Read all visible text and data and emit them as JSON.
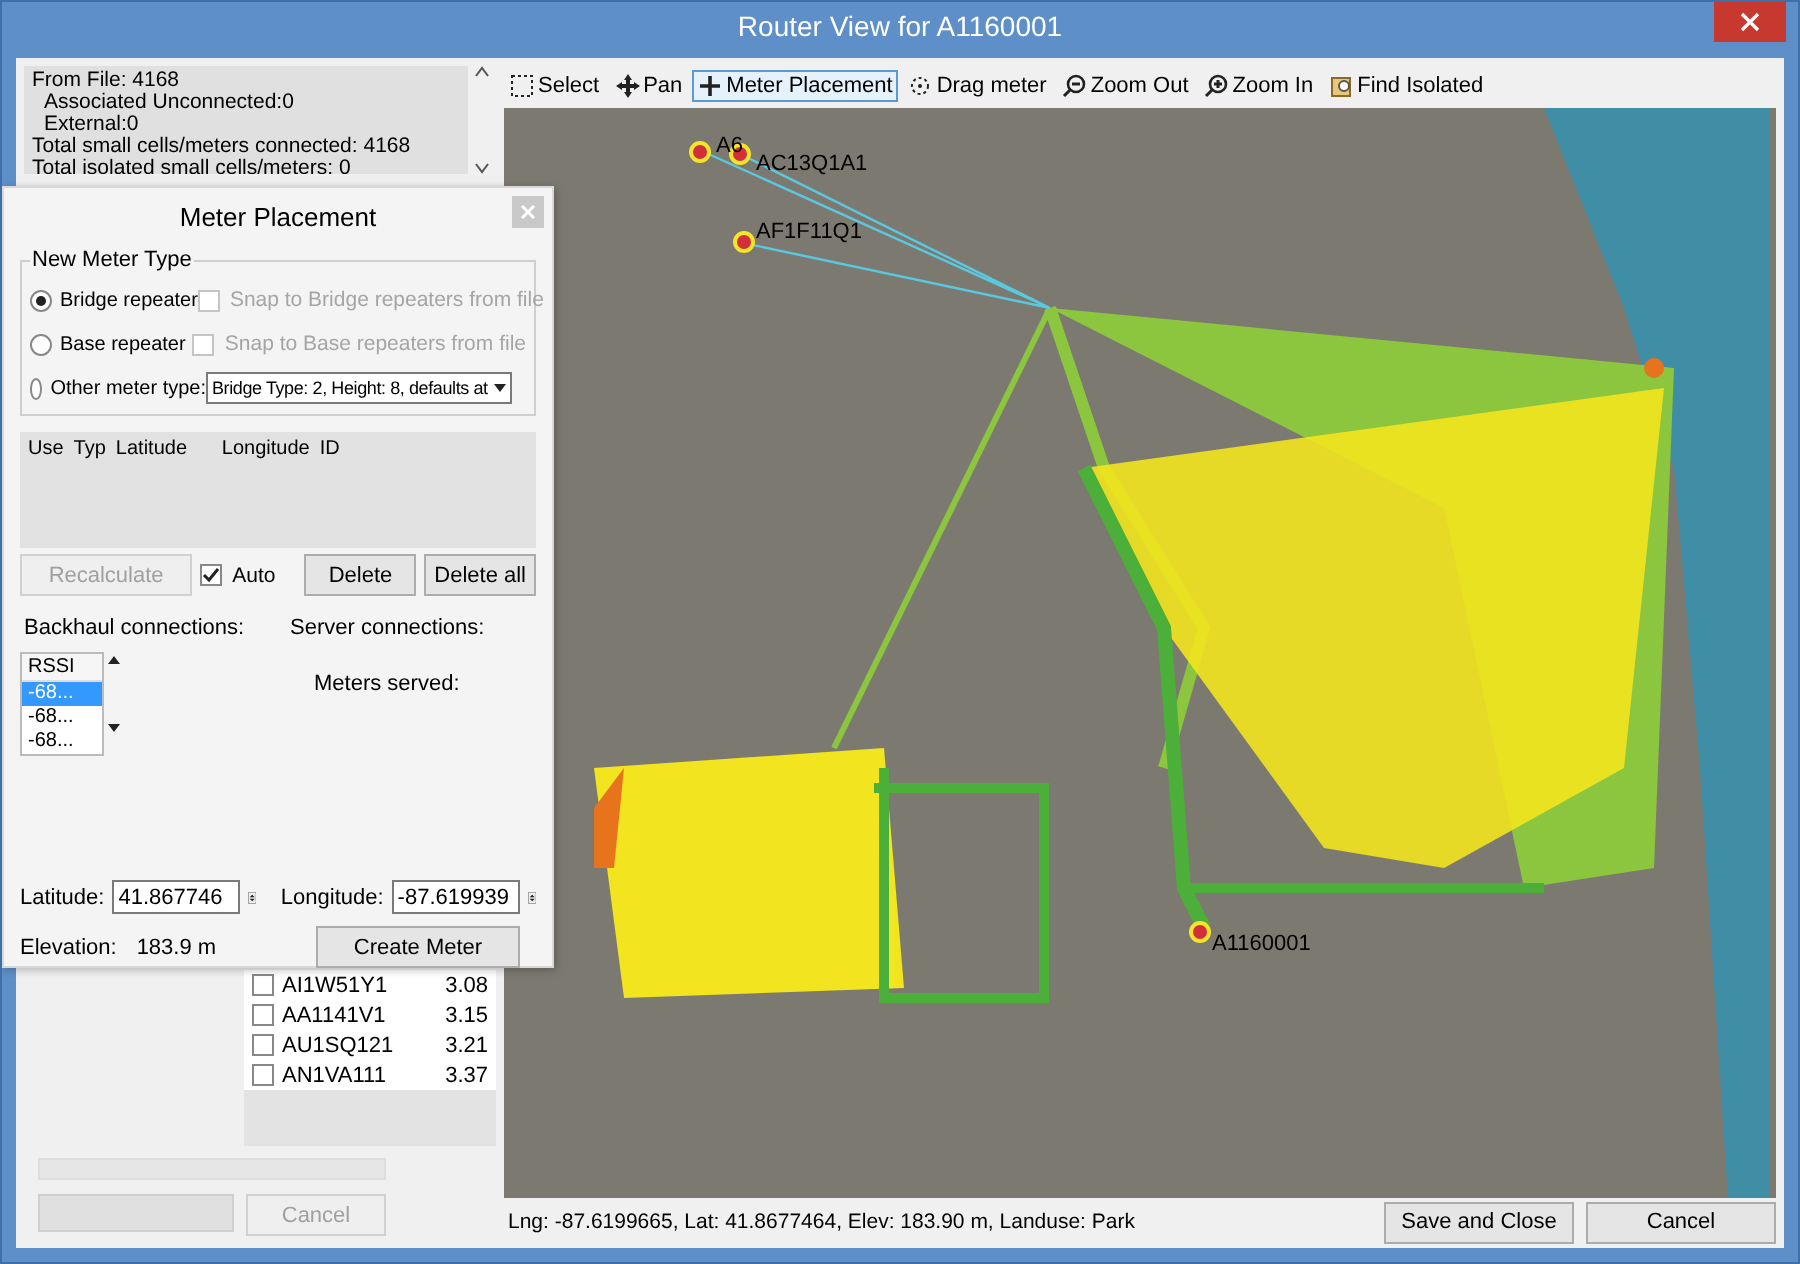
{
  "window": {
    "title": "Router View for A1160001"
  },
  "info_box": {
    "lines": [
      {
        "text": "From File: 4168",
        "indented": false
      },
      {
        "text": "Associated Unconnected:0",
        "indented": true
      },
      {
        "text": "External:0",
        "indented": true
      },
      {
        "text": "Total small cells/meters connected: 4168",
        "indented": false
      },
      {
        "text": "Total isolated small cells/meters: 0",
        "indented": false
      }
    ]
  },
  "toolbar": [
    {
      "kind": "select",
      "label": "Select",
      "selected": false
    },
    {
      "kind": "pan",
      "label": "Pan",
      "selected": false
    },
    {
      "kind": "plus",
      "label": "Meter Placement",
      "selected": true
    },
    {
      "kind": "drag",
      "label": "Drag meter",
      "selected": false
    },
    {
      "kind": "zoomout",
      "label": "Zoom Out",
      "selected": false
    },
    {
      "kind": "zoomin",
      "label": "Zoom In",
      "selected": false
    },
    {
      "kind": "find",
      "label": "Find Isolated",
      "selected": false
    }
  ],
  "map": {
    "routers": [
      {
        "label": "A6"
      },
      {
        "label": "AC13Q1A1"
      },
      {
        "label": "AF1F11Q1"
      },
      {
        "label": "A1160001"
      }
    ]
  },
  "status_text": "Lng: -87.6199665, Lat: 41.8677464, Elev: 183.90 m, Landuse: Park",
  "buttons": [
    "Save and Close",
    "Cancel"
  ],
  "dialog": {
    "title": "Meter Placement",
    "group_title": "New Meter Type",
    "meter_types": [
      {
        "kind": "snap",
        "label": "Bridge repeater",
        "selected": true,
        "snap": {
          "label": "Snap to Bridge repeaters from file",
          "checked": false,
          "disabled": true
        }
      },
      {
        "kind": "snap",
        "label": "Base repeater",
        "selected": false,
        "snap": {
          "label": "Snap to Base repeaters from file",
          "checked": false,
          "disabled": true
        }
      },
      {
        "kind": "dropdown",
        "label": "Other meter type:",
        "selected": false,
        "dropdown": "Bridge Type: 2, Height: 8, defaults at"
      }
    ],
    "table_columns": [
      "Use",
      "Typ",
      "Latitude",
      "Longitude",
      "ID"
    ],
    "recalculate": {
      "label": "Recalculate",
      "disabled": true
    },
    "auto": {
      "label": "Auto",
      "checked": true
    },
    "delete_buttons": [
      "Delete",
      "Delete all"
    ],
    "backhaul_label": "Backhaul connections:",
    "backhaul_list": {
      "header": "RSSI",
      "rows": [
        {
          "text": "-68...",
          "selected": true
        },
        {
          "text": "-68...",
          "selected": false
        },
        {
          "text": "-68...",
          "selected": false
        }
      ]
    },
    "server_label": "Server connections:",
    "meters_served_label": "Meters served:",
    "latitude": {
      "label": "Latitude:",
      "value": "41.867746"
    },
    "longitude": {
      "label": "Longitude:",
      "value": "-87.619939"
    },
    "elevation": {
      "label": "Elevation:",
      "value": "183.9 m"
    },
    "create_button": "Create Meter"
  },
  "router_list": [
    {
      "name": "AI1W51Y1",
      "km": "3.08",
      "checked": false
    },
    {
      "name": "AA1141V1",
      "km": "3.15",
      "checked": false
    },
    {
      "name": "AU1SQ121",
      "km": "3.21",
      "checked": false
    },
    {
      "name": "AN1VA111",
      "km": "3.37",
      "checked": false
    }
  ],
  "progress": {
    "level": 0
  },
  "cancel": {
    "label": "Cancel",
    "disabled": true
  }
}
